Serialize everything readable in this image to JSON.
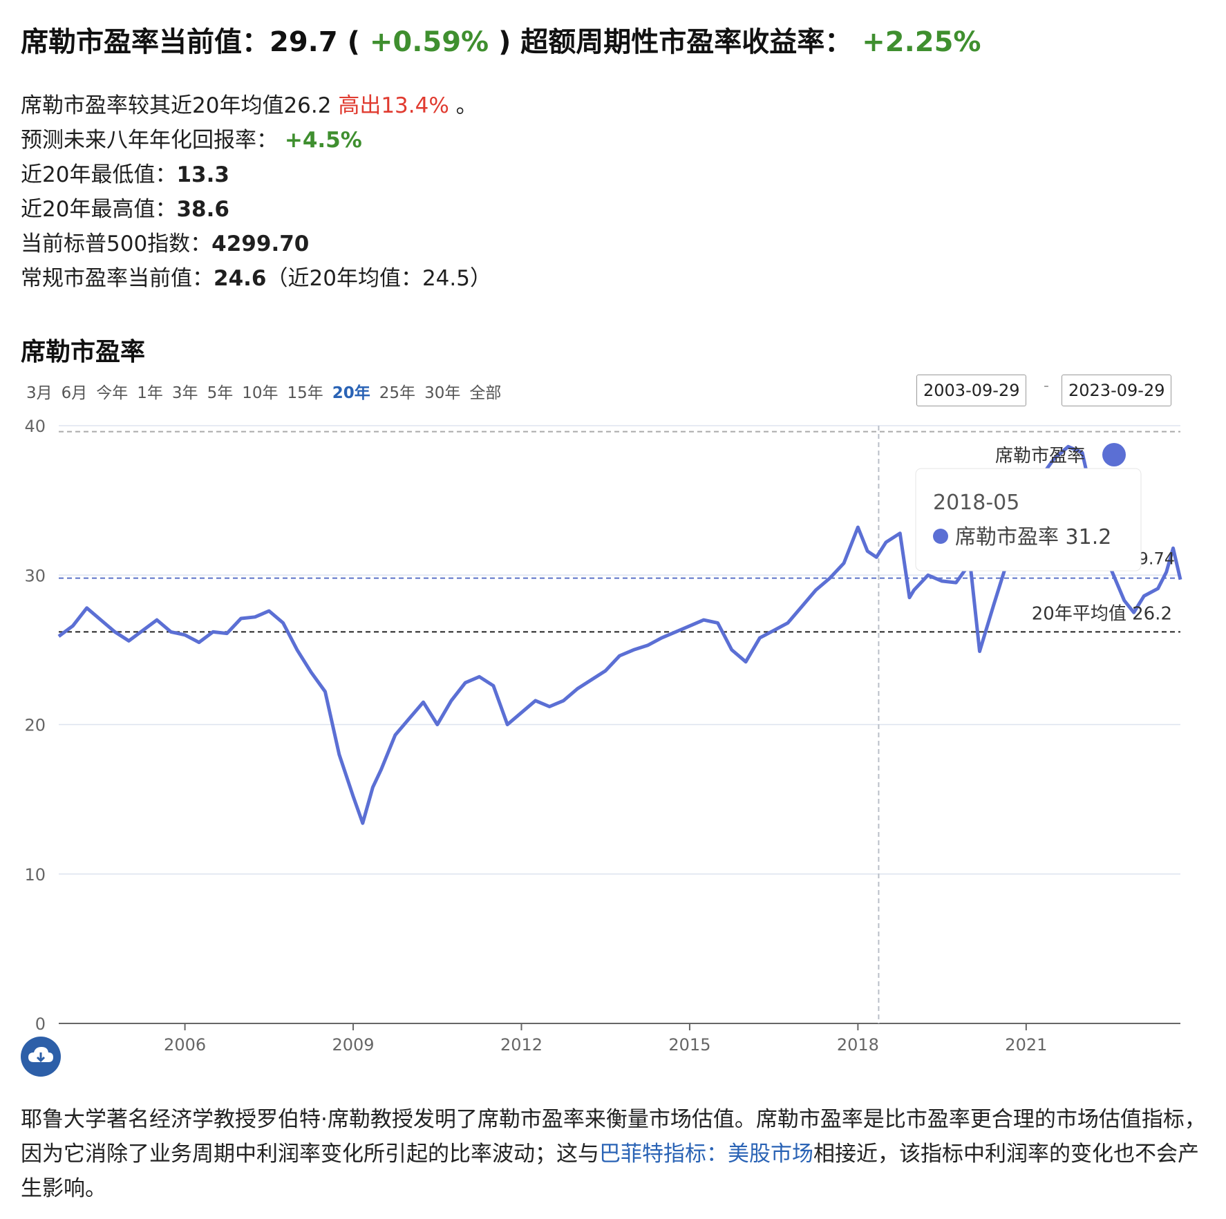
{
  "headline": {
    "label": "席勒市盈率当前值：",
    "value": "29.7",
    "open": " ( ",
    "change": "+0.59%",
    "close": " ) ",
    "excess_label": "超额周期性市盈率收益率：",
    "excess_value": "+2.25%"
  },
  "stats": {
    "vs_avg_prefix": "席勒市盈率较其近20年均值26.2 ",
    "vs_avg_highlight": "高出13.4%",
    "vs_avg_suffix": " 。",
    "forecast_label": "预测未来八年年化回报率：",
    "forecast_value": "+4.5%",
    "min_label": "近20年最低值：",
    "min_value": "13.3",
    "max_label": "近20年最高值：",
    "max_value": "38.6",
    "sp500_label": "当前标普500指数：",
    "sp500_value": "4299.70",
    "pe_label": "常规市盈率当前值：",
    "pe_value": "24.6",
    "pe_suffix": "（近20年均值：24.5）"
  },
  "chart_title": "席勒市盈率",
  "range_buttons": [
    "3月",
    "6月",
    "今年",
    "1年",
    "3年",
    "5年",
    "10年",
    "15年",
    "20年",
    "25年",
    "30年",
    "全部"
  ],
  "active_range": "20年",
  "date_range": {
    "start": "2003-09-29",
    "sep": "-",
    "end": "2023-09-29"
  },
  "chart_data": {
    "type": "line",
    "title": "席勒市盈率",
    "ylim": [
      0,
      40
    ],
    "y_ticks": [
      0,
      10,
      20,
      30,
      40
    ],
    "x_ticks": [
      "2006",
      "2009",
      "2012",
      "2015",
      "2018",
      "2021"
    ],
    "x_range": [
      2003.75,
      2023.75
    ],
    "grid": true,
    "legend": "top-right",
    "series": [
      {
        "name": "席勒市盈率",
        "color": "#5b6fd4",
        "points": [
          [
            2003.75,
            25.9
          ],
          [
            2004.0,
            26.6
          ],
          [
            2004.25,
            27.8
          ],
          [
            2004.5,
            27.0
          ],
          [
            2004.75,
            26.2
          ],
          [
            2005.0,
            25.6
          ],
          [
            2005.25,
            26.3
          ],
          [
            2005.5,
            27.0
          ],
          [
            2005.75,
            26.2
          ],
          [
            2006.0,
            26.0
          ],
          [
            2006.25,
            25.5
          ],
          [
            2006.5,
            26.2
          ],
          [
            2006.75,
            26.1
          ],
          [
            2007.0,
            27.1
          ],
          [
            2007.25,
            27.2
          ],
          [
            2007.5,
            27.6
          ],
          [
            2007.75,
            26.8
          ],
          [
            2008.0,
            25.0
          ],
          [
            2008.25,
            23.5
          ],
          [
            2008.5,
            22.2
          ],
          [
            2008.75,
            18.0
          ],
          [
            2009.0,
            15.2
          ],
          [
            2009.17,
            13.4
          ],
          [
            2009.35,
            15.8
          ],
          [
            2009.5,
            17.0
          ],
          [
            2009.75,
            19.3
          ],
          [
            2010.0,
            20.4
          ],
          [
            2010.25,
            21.5
          ],
          [
            2010.5,
            20.0
          ],
          [
            2010.75,
            21.6
          ],
          [
            2011.0,
            22.8
          ],
          [
            2011.25,
            23.2
          ],
          [
            2011.5,
            22.6
          ],
          [
            2011.75,
            20.0
          ],
          [
            2012.0,
            20.8
          ],
          [
            2012.25,
            21.6
          ],
          [
            2012.5,
            21.2
          ],
          [
            2012.75,
            21.6
          ],
          [
            2013.0,
            22.4
          ],
          [
            2013.25,
            23.0
          ],
          [
            2013.5,
            23.6
          ],
          [
            2013.75,
            24.6
          ],
          [
            2014.0,
            25.0
          ],
          [
            2014.25,
            25.3
          ],
          [
            2014.5,
            25.8
          ],
          [
            2014.75,
            26.2
          ],
          [
            2015.0,
            26.6
          ],
          [
            2015.25,
            27.0
          ],
          [
            2015.5,
            26.8
          ],
          [
            2015.75,
            25.0
          ],
          [
            2016.0,
            24.2
          ],
          [
            2016.25,
            25.8
          ],
          [
            2016.5,
            26.3
          ],
          [
            2016.75,
            26.8
          ],
          [
            2017.0,
            27.9
          ],
          [
            2017.25,
            29.0
          ],
          [
            2017.5,
            29.8
          ],
          [
            2017.75,
            30.8
          ],
          [
            2018.0,
            33.2
          ],
          [
            2018.17,
            31.6
          ],
          [
            2018.33,
            31.2
          ],
          [
            2018.5,
            32.2
          ],
          [
            2018.75,
            32.8
          ],
          [
            2018.92,
            28.5
          ],
          [
            2019.0,
            29.0
          ],
          [
            2019.25,
            30.0
          ],
          [
            2019.5,
            29.6
          ],
          [
            2019.75,
            29.5
          ],
          [
            2020.0,
            30.8
          ],
          [
            2020.17,
            24.9
          ],
          [
            2020.42,
            28.0
          ],
          [
            2020.67,
            31.0
          ],
          [
            2020.92,
            34.0
          ],
          [
            2021.25,
            36.5
          ],
          [
            2021.5,
            37.8
          ],
          [
            2021.75,
            38.6
          ],
          [
            2022.0,
            38.2
          ],
          [
            2022.25,
            34.0
          ],
          [
            2022.5,
            30.5
          ],
          [
            2022.75,
            28.3
          ],
          [
            2022.92,
            27.5
          ],
          [
            2023.1,
            28.6
          ],
          [
            2023.35,
            29.1
          ],
          [
            2023.5,
            30.2
          ],
          [
            2023.62,
            31.8
          ],
          [
            2023.75,
            29.7
          ]
        ]
      }
    ],
    "reference_lines": [
      {
        "label": "20年平均值 26.2",
        "value": 26.2
      },
      {
        "label": "",
        "value": 39.6
      },
      {
        "label": "",
        "value": 29.8
      }
    ],
    "current_label": "29.74",
    "legend_label": "席勒市盈率",
    "tooltip": {
      "date": "2018-05",
      "series": "席勒市盈率",
      "value": "31.2",
      "x": 2018.37
    }
  },
  "description": {
    "part1": "耶鲁大学著名经济学教授罗伯特·席勒教授发明了席勒市盈率来衡量市场估值。席勒市盈率是比市盈率更合理的市场估值指标，因为它消除了业务周期中利润率变化所引起的比率波动；这与",
    "link": "巴菲特指标：美股市场",
    "part2": "相接近，该指标中利润率的变化也不会产生影响。"
  }
}
